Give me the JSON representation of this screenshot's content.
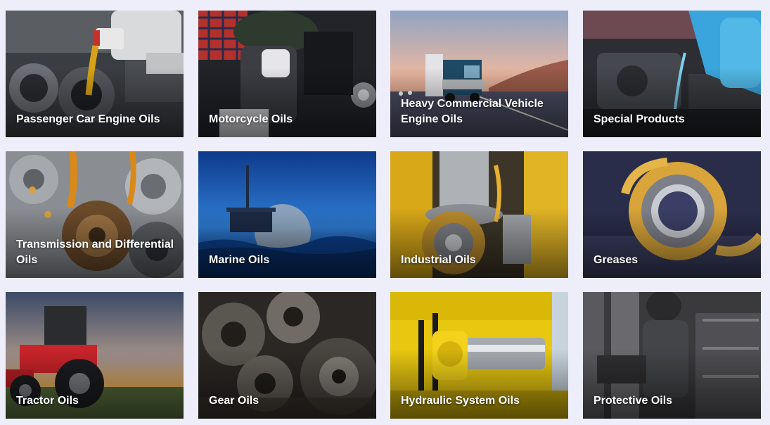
{
  "categories": [
    {
      "label": "Passenger Car Engine Oils"
    },
    {
      "label": "Motorcycle Oils"
    },
    {
      "label": "Heavy Commercial Vehicle Engine Oils"
    },
    {
      "label": "Special Products"
    },
    {
      "label": "Transmission and Differential Oils"
    },
    {
      "label": "Marine Oils"
    },
    {
      "label": "Industrial Oils"
    },
    {
      "label": "Greases"
    },
    {
      "label": "Tractor Oils"
    },
    {
      "label": "Gear Oils"
    },
    {
      "label": "Hydraulic System Oils"
    },
    {
      "label": "Protective Oils"
    }
  ],
  "colors": {
    "background": "#eeeefb",
    "label_text": "#ffffff"
  }
}
